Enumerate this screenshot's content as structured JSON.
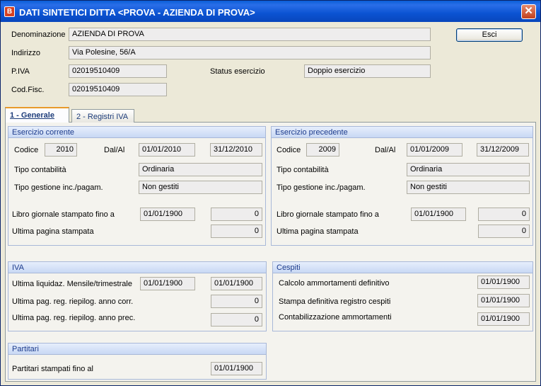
{
  "window": {
    "title": "DATI SINTETICI DITTA <PROVA - AZIENDA DI PROVA>",
    "app_icon": "app-logo-icon",
    "close_glyph": "✕"
  },
  "header": {
    "denominazione_label": "Denominazione",
    "denominazione_value": "AZIENDA DI PROVA",
    "indirizzo_label": "Indirizzo",
    "indirizzo_value": "Via Polesine, 56/A",
    "piva_label": "P.IVA",
    "piva_value": "02019510409",
    "status_label": "Status esercizio",
    "status_value": "Doppio esercizio",
    "codfisc_label": "Cod.Fisc.",
    "codfisc_value": "02019510409",
    "esci_label": "Esci"
  },
  "tabs": [
    {
      "label": "1 - Generale"
    },
    {
      "label": "2 - Registri IVA"
    }
  ],
  "esercizio_corrente": {
    "title": "Esercizio corrente",
    "codice_label": "Codice",
    "codice_value": "2010",
    "dalal_label": "Dal/Al",
    "dal_value": "01/01/2010",
    "al_value": "31/12/2010",
    "tipo_contabilita_label": "Tipo contabilità",
    "tipo_contabilita_value": "Ordinaria",
    "tipo_gestione_label": "Tipo gestione inc./pagam.",
    "tipo_gestione_value": "Non gestiti",
    "libro_label": "Libro giornale stampato fino a",
    "libro_date": "01/01/1900",
    "libro_num": "0",
    "ultima_label": "Ultima pagina stampata",
    "ultima_value": "0"
  },
  "esercizio_precedente": {
    "title": "Esercizio precedente",
    "codice_label": "Codice",
    "codice_value": "2009",
    "dalal_label": "Dal/Al",
    "dal_value": "01/01/2009",
    "al_value": "31/12/2009",
    "tipo_contabilita_label": "Tipo contabilità",
    "tipo_contabilita_value": "Ordinaria",
    "tipo_gestione_label": "Tipo gestione inc./pagam.",
    "tipo_gestione_value": "Non gestiti",
    "libro_label": "Libro giornale stampato fino a",
    "libro_date": "01/01/1900",
    "libro_num": "0",
    "ultima_label": "Ultima pagina stampata",
    "ultima_value": "0"
  },
  "iva": {
    "title": "IVA",
    "liquidaz_label": "Ultima liquidaz. Mensile/trimestrale",
    "liquidaz_date1": "01/01/1900",
    "liquidaz_date2": "01/01/1900",
    "corr_label": "Ultima pag. reg. riepilog. anno corr.",
    "corr_value": "0",
    "prec_label": "Ultima pag. reg. riepilog. anno prec.",
    "prec_value": "0"
  },
  "cespiti": {
    "title": "Cespiti",
    "calcolo_label": "Calcolo ammortamenti definitivo",
    "calcolo_value": "01/01/1900",
    "stampa_label": "Stampa definitiva registro cespiti",
    "stampa_value": "01/01/1900",
    "contab_label": "Contabilizzazione ammortamenti",
    "contab_value": "01/01/1900"
  },
  "partitari": {
    "title": "Partitari",
    "stampati_label": "Partitari stampati fino al",
    "stampati_value": "01/01/1900"
  }
}
